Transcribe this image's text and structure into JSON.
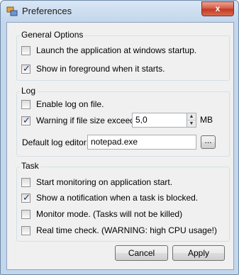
{
  "window": {
    "title": "Preferences",
    "close_glyph": "x"
  },
  "general": {
    "legend": "General Options",
    "launch_startup": {
      "label": "Launch the application at windows startup.",
      "checked": false
    },
    "foreground": {
      "label": "Show in foreground when it starts.",
      "checked": true
    }
  },
  "log": {
    "legend": "Log",
    "enable": {
      "label": "Enable log on file.",
      "checked": false
    },
    "warning": {
      "label": "Warning if file size exceeds:",
      "checked": true
    },
    "size_value": "5,0",
    "size_unit": "MB",
    "editor_label": "Default log editor:",
    "editor_value": "notepad.exe",
    "browse_label": "..."
  },
  "task": {
    "legend": "Task",
    "start_monitoring": {
      "label": "Start monitoring on application start.",
      "checked": false
    },
    "notify_blocked": {
      "label": "Show a notification when a task is blocked.",
      "checked": true
    },
    "monitor_mode": {
      "label": "Monitor mode. (Tasks will not be killed)",
      "checked": false
    },
    "realtime": {
      "label": "Real time check. (WARNING: high CPU usage!)",
      "checked": false
    }
  },
  "buttons": {
    "cancel": "Cancel",
    "apply": "Apply"
  }
}
